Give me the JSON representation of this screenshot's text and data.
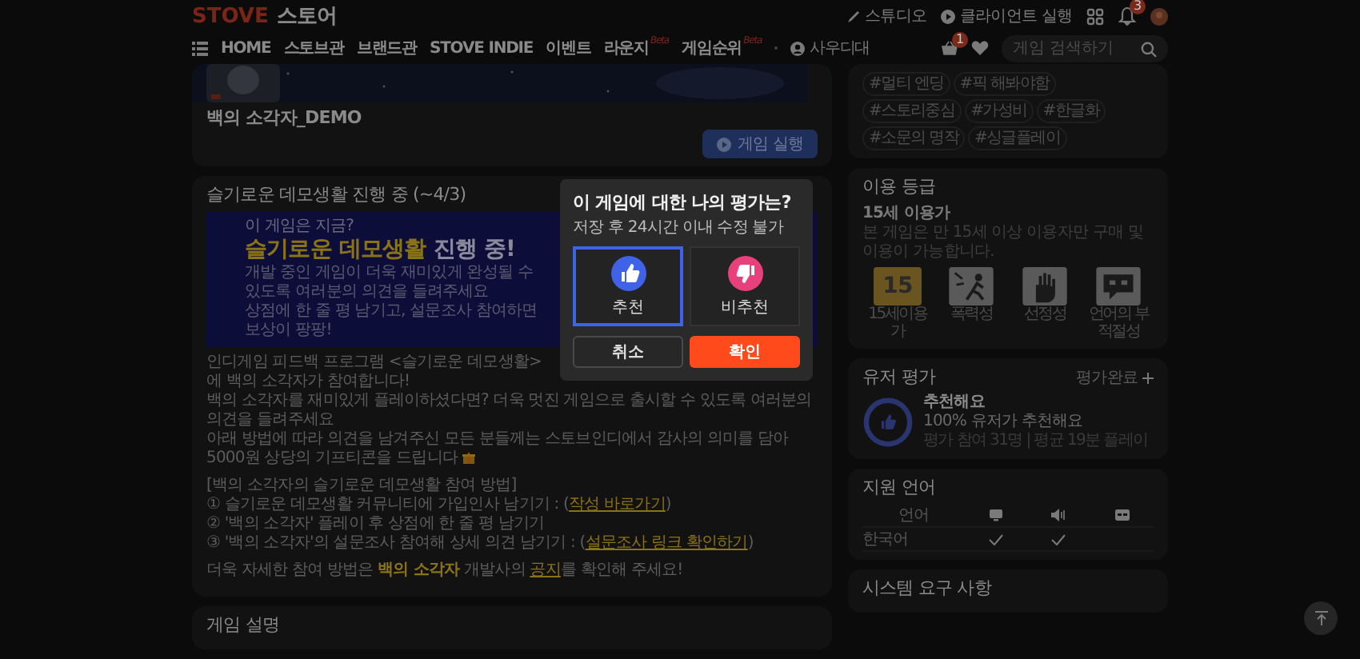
{
  "header": {
    "logo": {
      "brand": "STOVE",
      "name": "스토어"
    },
    "utility_links": [
      {
        "label": "스튜디오"
      },
      {
        "label": "클라이언트 실행"
      }
    ],
    "notification_badge": "3"
  },
  "nav": {
    "items": [
      {
        "label": "HOME"
      },
      {
        "label": "스토브관"
      },
      {
        "label": "브랜드관"
      },
      {
        "label": "STOVE INDIE"
      },
      {
        "label": "이벤트"
      },
      {
        "label": "라운지",
        "tag": "Beta"
      },
      {
        "label": "게임순위",
        "tag": "Beta"
      }
    ],
    "user": "사우디대",
    "cart_badge": "1",
    "search": {
      "placeholder": "게임 검색하기"
    }
  },
  "game": {
    "title": "백의 소각자_DEMO",
    "play_button": "게임 실행"
  },
  "event": {
    "heading": "슬기로운 데모생활 진행 중 (~4/3)",
    "banner": {
      "kicker": "이 게임은 지금?",
      "headline_highlight": "슬기로운 데모생활",
      "headline_rest": "진행 중!",
      "lines": [
        "개발 중인 게임이 더욱 재미있게 완성될 수 있도록 여러분의 의견을 들려주세요",
        "상점에 한 줄 평 남기고, 설문조사 참여하면 보상이 팡팡!"
      ]
    },
    "groups": [
      [
        [
          {
            "kind": "text",
            "text": "인디게임 피드백 프로그램 <슬기로운 데모생활>에 백의 소각자가 참여합니다!"
          }
        ],
        [
          {
            "kind": "text",
            "text": "백의 소각자를 재미있게 플레이하셨다면? 더욱 멋진 게임으로 출시할 수 있도록 여러분의 의견을 들려주세요"
          }
        ],
        [
          {
            "kind": "text",
            "text": "아래 방법에 따라 의견을 남겨주신 모든 분들께는 스토브인디에서 감사의 의미를 담아 5000원 상당의 기프티콘을 드립니다 "
          },
          {
            "kind": "gift"
          }
        ]
      ],
      [
        [
          {
            "kind": "text",
            "text": "[백의 소각자의 슬기로운 데모생활 참여 방법]"
          }
        ],
        [
          {
            "kind": "text",
            "text": "① 슬기로운 데모생활 커뮤니티에 가입인사 남기기 : ("
          },
          {
            "kind": "link",
            "text": "작성 바로가기"
          },
          {
            "kind": "text",
            "text": ")"
          }
        ],
        [
          {
            "kind": "text",
            "text": "② '백의 소각자' 플레이 후 상점에 한 줄 평 남기기"
          }
        ],
        [
          {
            "kind": "text",
            "text": "③ '백의 소각자'의 설문조사 참여해 상세 의견 남기기 : ("
          },
          {
            "kind": "link",
            "text": "설문조사 링크 확인하기"
          },
          {
            "kind": "text",
            "text": ")"
          }
        ]
      ],
      [
        [
          {
            "kind": "text",
            "text": "더욱 자세한 참여 방법은 "
          },
          {
            "kind": "highlight",
            "text": "백의 소각자"
          },
          {
            "kind": "text",
            "text": " 개발사의 "
          },
          {
            "kind": "link",
            "text": "공지"
          },
          {
            "kind": "text",
            "text": "를 확인해 주세요!"
          }
        ]
      ]
    ]
  },
  "next_section": {
    "title": "게임 설명"
  },
  "tags": [
    "#멀티 엔딩",
    "#픽 해봐야함",
    "#스토리중심",
    "#가성비",
    "#한글화",
    "#소문의 명작",
    "#싱글플레이"
  ],
  "age_rating": {
    "title": "이용 등급",
    "rating": "15세 이용가",
    "description": "본 게임은 만 15세 이상 이용자만 구매 및 이용이 가능합니다.",
    "badges": [
      {
        "kind": "age",
        "number": "15",
        "label": "15세이용가"
      },
      {
        "kind": "violence",
        "label": "폭력성"
      },
      {
        "kind": "sexual",
        "label": "선정성"
      },
      {
        "kind": "language",
        "label": "언어의 부적절성"
      }
    ]
  },
  "user_review": {
    "title": "유저 평가",
    "action": "평가완료",
    "verdict": "추천해요",
    "summary": "100% 유저가 추천해요",
    "stats": "평가 참여 31명 | 평균 19분 플레이"
  },
  "languages": {
    "title": "지원 언어",
    "column_label": "언어",
    "columns": [
      {
        "kind": "interface"
      },
      {
        "kind": "voice"
      },
      {
        "kind": "subtitles"
      }
    ],
    "rows": [
      {
        "name": "한국어",
        "support": [
          true,
          true,
          false
        ]
      }
    ]
  },
  "system_requirements": {
    "title": "시스템 요구 사항"
  },
  "modal": {
    "title": "이 게임에 대한 나의 평가는?",
    "note": "저장 후 24시간 이내 수정 불가",
    "options": [
      {
        "kind": "up",
        "label": "추천",
        "selected": true
      },
      {
        "kind": "down",
        "label": "비추천",
        "selected": false
      }
    ],
    "cancel": "취소",
    "confirm": "확인"
  }
}
